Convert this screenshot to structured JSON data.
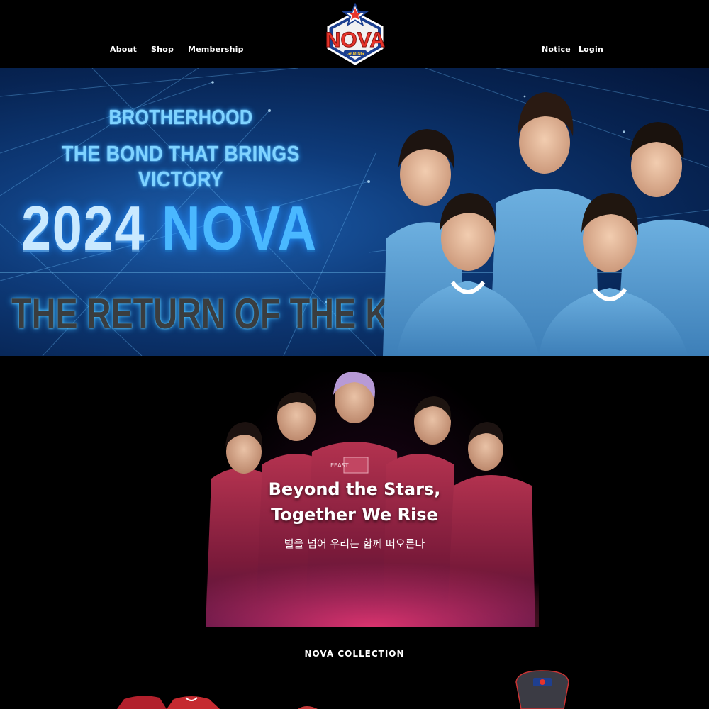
{
  "nav": {
    "left": [
      "About",
      "Shop",
      "Membership"
    ],
    "right": [
      "Notice",
      "Login"
    ],
    "logo_text": "NOVA",
    "logo_sub": "GAMING"
  },
  "hero": {
    "line1": "BROTHERHOOD",
    "line2": "THE BOND THAT BRINGS VICTORY",
    "year": "2024",
    "team": "NOVA",
    "tagline": "THE RETURN OF THE KING"
  },
  "section2": {
    "title_line1": "Beyond the Stars,",
    "title_line2": "Together We Rise",
    "subtitle": "별을 넘어 우리는 함께 떠오른다",
    "jersey_text": "EEAST"
  },
  "collection": {
    "title": "NOVA COLLECTION"
  },
  "colors": {
    "background": "#000000",
    "hero_blue": "#0e3b7a",
    "neon": "#4ab8ff",
    "jersey_light_blue": "#5fa3d6",
    "jersey_red": "#9a1f3e",
    "logo_red": "#e8342a"
  },
  "icons": {
    "logo": "nova-star-shield-logo"
  }
}
